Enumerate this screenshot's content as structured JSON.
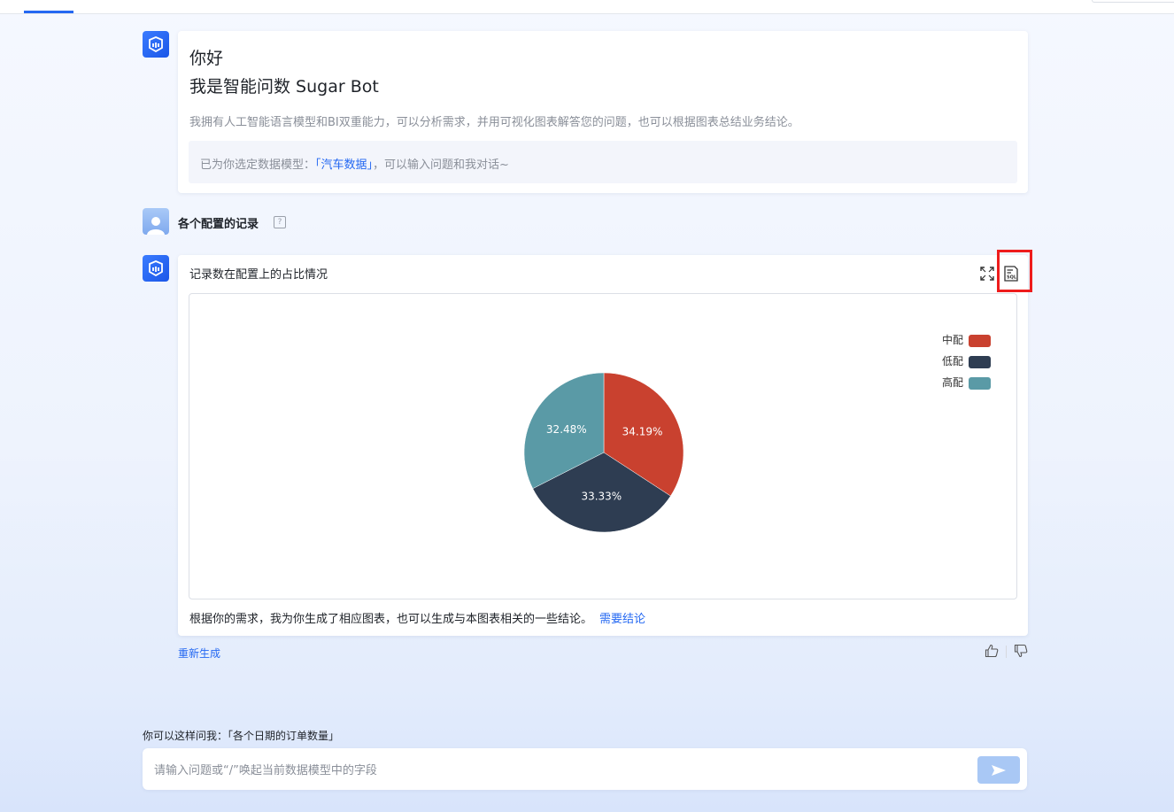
{
  "greeting": {
    "title": "你好",
    "subtitle": "我是智能问数 Sugar Bot",
    "description": "我拥有人工智能语言模型和BI双重能力，可以分析需求，并用可视化图表解答您的问题，也可以根据图表总结业务结论。",
    "model_prefix": "已为你选定数据模型：",
    "model_name": "「汽车数据」",
    "model_suffix": "，可以输入问题和我对话~"
  },
  "user_question": {
    "text": "各个配置的记录",
    "edit_icon": "edit-square-icon"
  },
  "chart_card": {
    "title": "记录数在配置上的占比情况",
    "footer_text": "根据你的需求，我为你生成了相应图表，也可以生成与本图表相关的一些结论。",
    "footer_link": "需要结论"
  },
  "chart_data": {
    "type": "pie",
    "title": "记录数在配置上的占比情况",
    "categories": [
      "中配",
      "低配",
      "高配"
    ],
    "values": [
      34.19,
      33.33,
      32.48
    ],
    "labels": [
      "34.19%",
      "33.33%",
      "32.48%"
    ],
    "colors": [
      "#c9412f",
      "#2e3d52",
      "#5a9aa6"
    ],
    "legend_position": "top-right"
  },
  "actions": {
    "regenerate": "重新生成",
    "like_icon": "thumbs-up-icon",
    "dislike_icon": "thumbs-down-icon"
  },
  "suggestion": {
    "text": "你可以这样问我：「各个日期的订单数量」"
  },
  "input": {
    "placeholder": "请输入问题或“/”唤起当前数据模型中的字段",
    "value": ""
  },
  "icons": {
    "bot": "bot-logo-icon",
    "expand": "expand-icon",
    "sql": "sql-icon",
    "send": "send-icon"
  }
}
